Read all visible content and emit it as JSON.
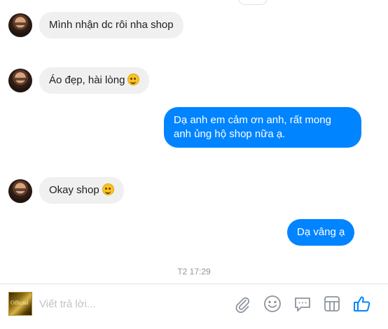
{
  "messages": [
    {
      "direction": "incoming",
      "text": "Mình nhận dc rôi nha shop"
    },
    {
      "direction": "incoming",
      "text": "Áo đẹp, hài lòng",
      "emoji": "smile-emoji"
    },
    {
      "direction": "outgoing",
      "text": "Dạ anh em cảm ơn anh, rất mong anh ủng hộ shop nữa ạ."
    },
    {
      "direction": "incoming",
      "text": "Okay shop",
      "emoji": "smile-emoji"
    },
    {
      "direction": "outgoing",
      "text": "Dạ vâng ạ"
    }
  ],
  "timestamp": "T2 17:29",
  "composer": {
    "avatar_text": "Official",
    "placeholder": "Viết trả lời...",
    "tools": [
      "paperclip-icon",
      "emoji-icon",
      "sticker-icon",
      "gif-icon",
      "like-icon"
    ]
  },
  "colors": {
    "outgoing_bubble": "#0084ff",
    "incoming_bubble": "#f1f0f0",
    "icon": "#8d949e",
    "like": "#0084ff"
  }
}
